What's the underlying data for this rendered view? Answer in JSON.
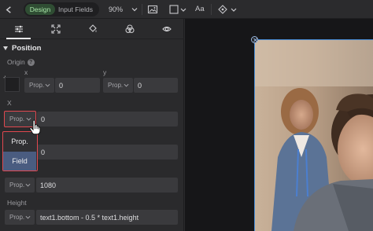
{
  "topbar": {
    "mode_design": "Design",
    "mode_input_fields": "Input Fields",
    "zoom": "90%",
    "text_tool": "Aa"
  },
  "tabs": [
    {
      "name": "properties",
      "icon": "sliders-icon"
    },
    {
      "name": "resize",
      "icon": "expand-icon"
    },
    {
      "name": "fill",
      "icon": "paint-bucket-icon"
    },
    {
      "name": "effects",
      "icon": "color-circles-icon"
    },
    {
      "name": "visibility",
      "icon": "eye-icon"
    }
  ],
  "section": {
    "title": "Position",
    "origin_label": "Origin",
    "origin_plus": "+",
    "x_label": "x",
    "y_label": "y",
    "origin_x_mode": "Prop.",
    "origin_x_value": "0",
    "origin_y_mode": "Prop.",
    "origin_y_value": "0",
    "X_label": "X",
    "X_mode": "Prop.",
    "X_value": "0",
    "Y_value": "0",
    "width_mode": "Prop.",
    "width_value": "1080",
    "height_label": "Height",
    "height_mode": "Prop.",
    "height_value": "text1.bottom - 0.5 * text1.height"
  },
  "dropdown": {
    "options": [
      "Prop.",
      "Field"
    ],
    "highlighted": "Field"
  },
  "colors": {
    "accent_red": "#e0484f",
    "design_green": "#a6e3a6",
    "selection_blue": "#4a8fd8",
    "dropdown_highlight": "#4a5c80"
  }
}
